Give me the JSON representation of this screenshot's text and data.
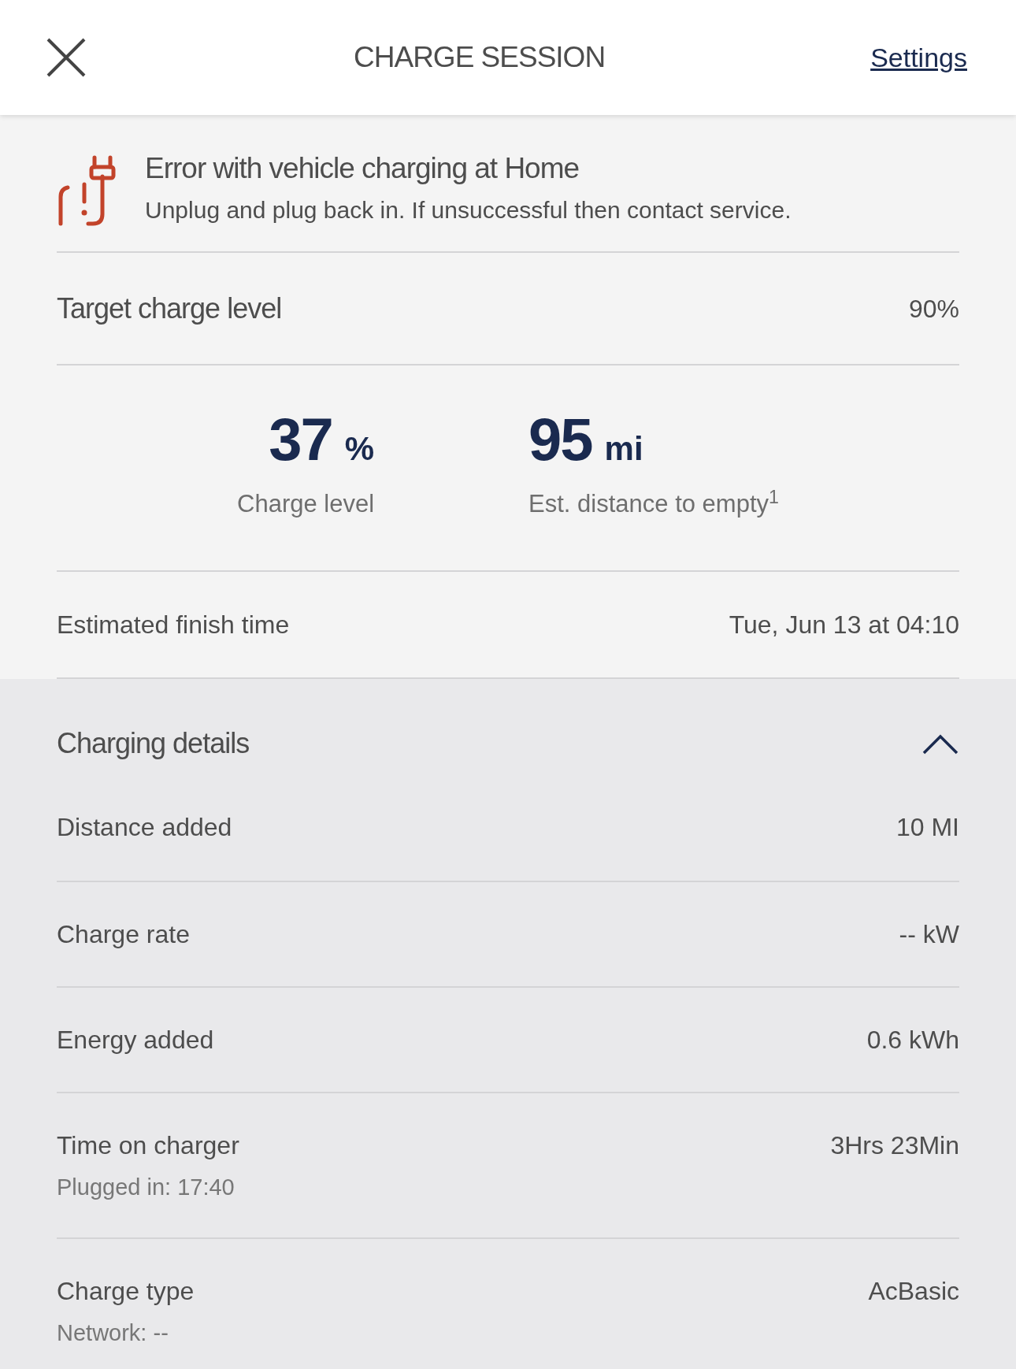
{
  "header": {
    "title": "CHARGE SESSION",
    "settings_link": "Settings"
  },
  "alert": {
    "title": "Error with vehicle charging at Home",
    "message": "Unplug and plug back in. If unsuccessful then contact service."
  },
  "target": {
    "label": "Target charge level",
    "value": "90%"
  },
  "stats": [
    {
      "number": "37",
      "unit": "%",
      "caption": "Charge level"
    },
    {
      "number": "95",
      "unit": "mi",
      "caption": "Est. distance to empty$^{1}$"
    }
  ],
  "finish": {
    "label": "Estimated finish time",
    "value": "Tue, Jun 13 at 04:10"
  },
  "details": {
    "title": "Charging details",
    "expanded": true,
    "rows": [
      {
        "label": "Distance added",
        "value": "10 MI"
      },
      {
        "label": "Charge rate",
        "value": "-- kW"
      },
      {
        "label": "Energy added",
        "value": "0.6 kWh"
      },
      {
        "label": "Time on charger",
        "value": "3Hrs 23Min",
        "sub": "Plugged in: 17:40"
      },
      {
        "label": "Charge type",
        "value": "AcBasic",
        "sub": "Network: --"
      }
    ]
  }
}
